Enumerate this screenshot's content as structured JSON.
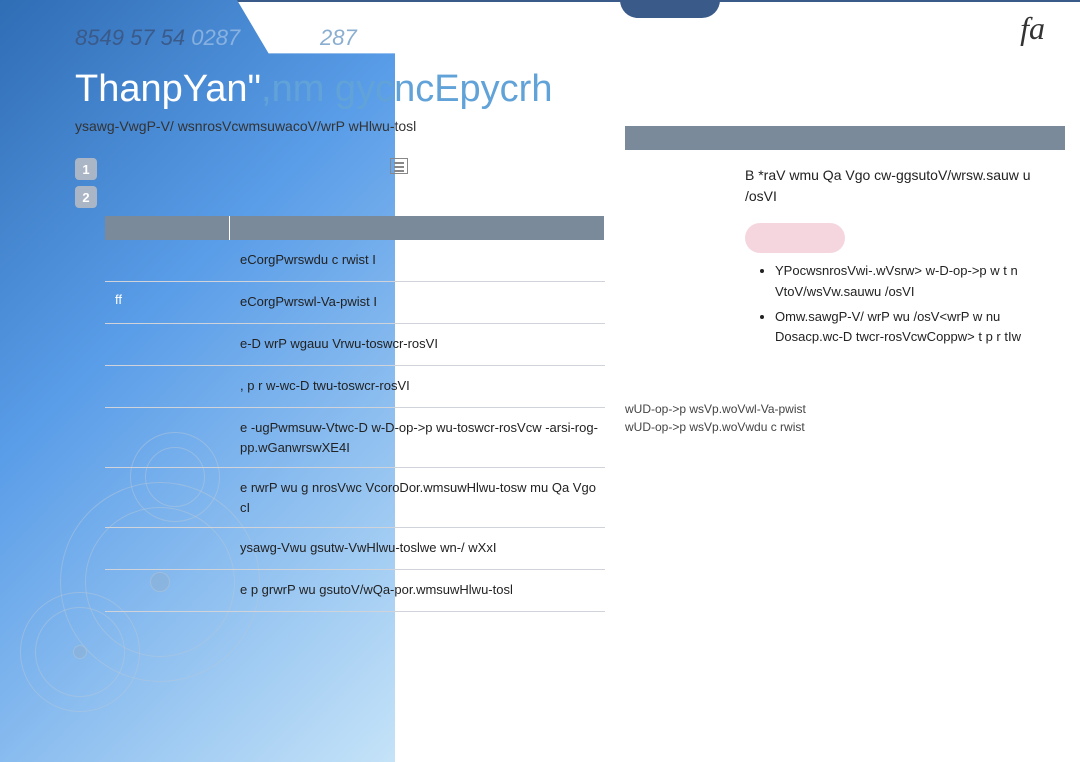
{
  "header": {
    "nums_left": "8549 57 54",
    "nums_white": " 0287",
    "nums_small": "287"
  },
  "logo": "fa",
  "title": {
    "white": "ThanpYan\"",
    "blue": ",nm gycncEpycrh"
  },
  "subtitle": "ysawg-VwgP-V/ wsnrosVcwmsuwacoV/wrP wHlwu-tosl",
  "badges": [
    "1",
    "2"
  ],
  "table": {
    "rows": [
      {
        "left": " ",
        "right": "eCorgPwrswdu c rwist I"
      },
      {
        "left": "  ff",
        "right": "eCorgPwrswl-Va-pwist I"
      },
      {
        "left": " ",
        "right": "e-D wrP wgauu Vrwu-toswcr-rosVI"
      },
      {
        "left": " ",
        "right": ", p r w-wc-D twu-toswcr-rosVI"
      },
      {
        "left": " ",
        "right": "e -ugPwmsuw-Vtwc-D w-D-op->p wu-toswcr-rosVcw -arsi-rog-pp.wGanwrswXE4I"
      },
      {
        "left": " ",
        "right": "e rwrP wu g nrosVwc VcoroDor.wmsuwHlwu-tosw mu Qa Vgo cI"
      },
      {
        "left": " ",
        "right": "ysawg-Vwu gsutw-VwHlwu-toslwe  wn-/ wXxI"
      },
      {
        "left": " ",
        "right": "e p grwrP wu gsutoV/wQa-por.wmsuwHlwu-tosl"
      }
    ]
  },
  "right": {
    "text": "B *raV wmu Qa Vgo cw-ggsutoV/wrsw.sauw u /osVI",
    "bullets": [
      "YPocwsnrosVwi-.wVsrw> w-D-op->p w t n VtoV/wsVw.sauwu /osVI",
      "Omw.sawgP-V/ wrP wu /osV<wrP w nu Dosacp.wc-D twcr-rosVcwCoppw> t p r tIw"
    ]
  },
  "footerlinks": {
    "l1": "wUD-op->p wsVp.woVwl-Va-pwist",
    "l2": "wUD-op->p wsVp.woVwdu c rwist"
  }
}
